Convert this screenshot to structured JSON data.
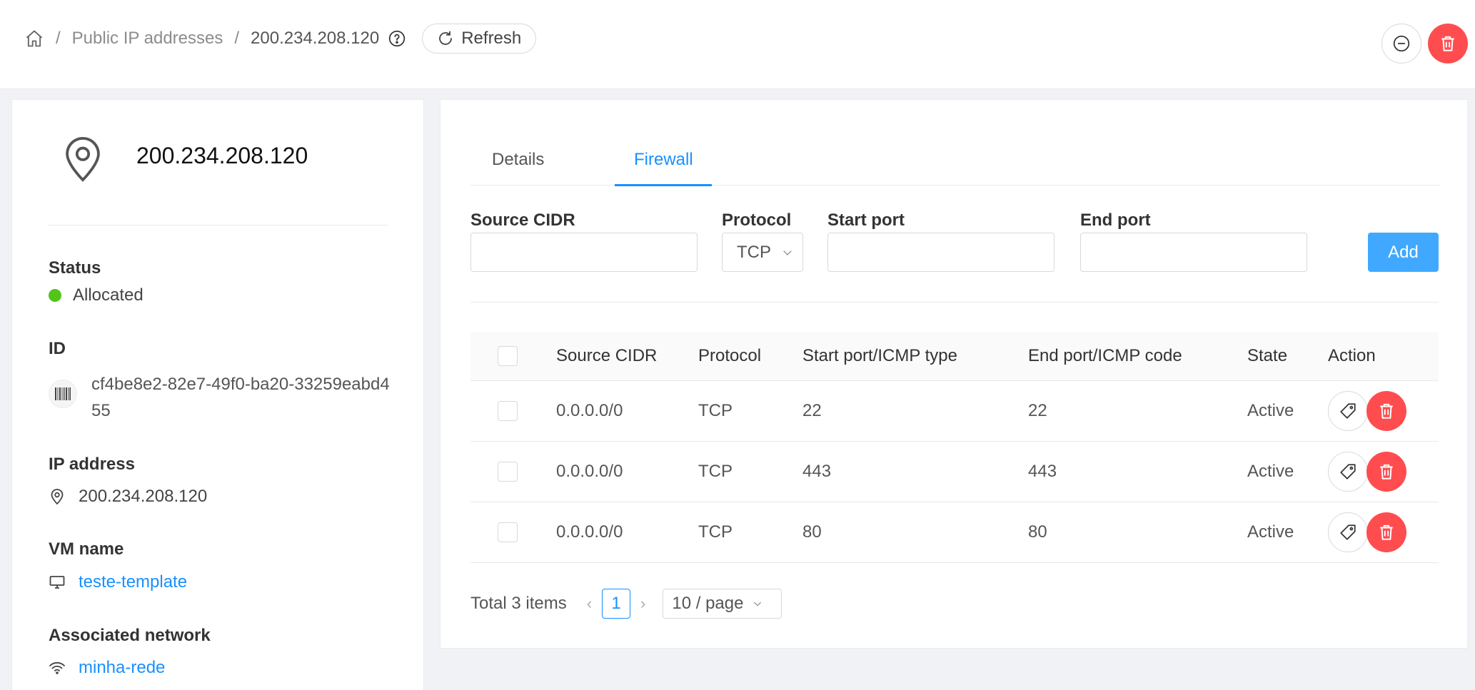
{
  "header": {
    "breadcrumb": {
      "home": "home",
      "section": "Public IP addresses",
      "current": "200.234.208.120"
    },
    "refresh_label": "Refresh"
  },
  "summary": {
    "title": "200.234.208.120",
    "status_label": "Status",
    "status_value": "Allocated",
    "status_color": "#52c41a",
    "id_label": "ID",
    "id_value": "cf4be8e2-82e7-49f0-ba20-33259eabd455",
    "ip_label": "IP address",
    "ip_value": "200.234.208.120",
    "vm_label": "VM name",
    "vm_value": "teste-template",
    "network_label": "Associated network",
    "network_value": "minha-rede"
  },
  "tabs": [
    {
      "label": "Details",
      "active": false
    },
    {
      "label": "Firewall",
      "active": true
    }
  ],
  "form": {
    "source_cidr_label": "Source CIDR",
    "protocol_label": "Protocol",
    "protocol_value": "TCP",
    "start_port_label": "Start port",
    "end_port_label": "End port",
    "add_label": "Add"
  },
  "table": {
    "columns": [
      "Source CIDR",
      "Protocol",
      "Start port/ICMP type",
      "End port/ICMP code",
      "State",
      "Action"
    ],
    "rows": [
      {
        "source": "0.0.0.0/0",
        "protocol": "TCP",
        "start": "22",
        "end": "22",
        "state": "Active"
      },
      {
        "source": "0.0.0.0/0",
        "protocol": "TCP",
        "start": "443",
        "end": "443",
        "state": "Active"
      },
      {
        "source": "0.0.0.0/0",
        "protocol": "TCP",
        "start": "80",
        "end": "80",
        "state": "Active"
      }
    ]
  },
  "pagination": {
    "total": "Total 3 items",
    "current_page": "1",
    "page_size": "10 / page"
  },
  "colors": {
    "accent": "#1890ff",
    "danger": "#ff4d4f",
    "primary_button": "#40a9ff"
  }
}
